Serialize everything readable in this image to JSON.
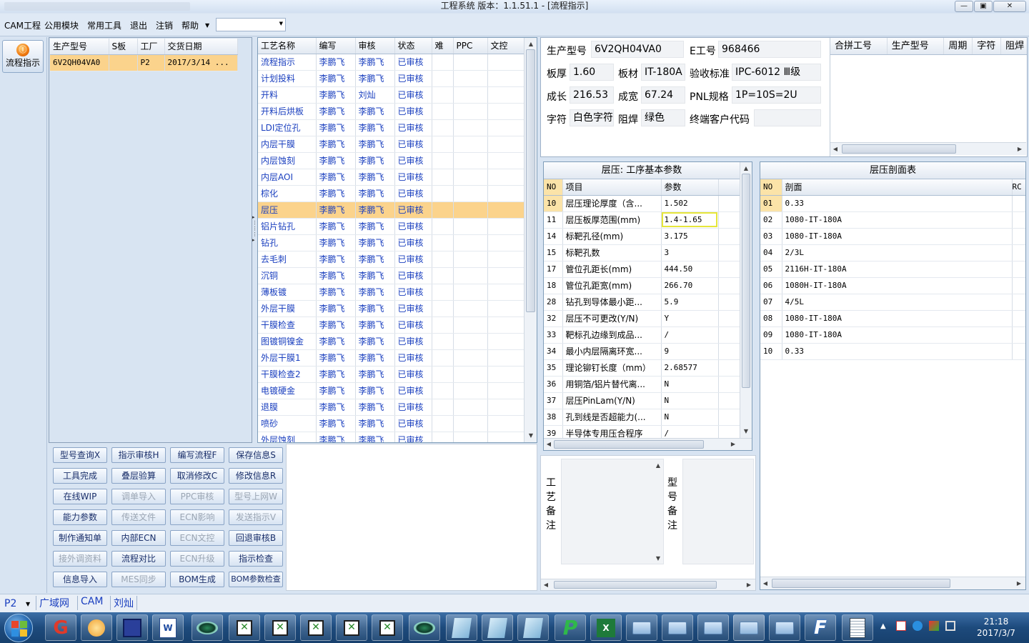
{
  "window": {
    "title": "工程系统   版本：1.1.51.1 - [流程指示]"
  },
  "menu": {
    "items": [
      "CAM工程",
      "公用模块",
      "常用工具",
      "退出",
      "注销",
      "帮助"
    ],
    "combo_value": ""
  },
  "nav": {
    "button_label": "流程指示"
  },
  "orders": {
    "columns": [
      "生产型号",
      "S板",
      "工厂",
      "交货日期"
    ],
    "rows": [
      [
        "6V2QH04VA0",
        "",
        "P2",
        "2017/3/14 ..."
      ]
    ]
  },
  "process": {
    "columns": [
      "工艺名称",
      "编写",
      "审核",
      "状态",
      "难",
      "PPC",
      "文控"
    ],
    "rows": [
      [
        "流程指示",
        "李鹏飞",
        "李鹏飞",
        "已审核"
      ],
      [
        "计划投料",
        "李鹏飞",
        "李鹏飞",
        "已审核"
      ],
      [
        "开料",
        "李鹏飞",
        "刘灿",
        "已审核"
      ],
      [
        "开料后烘板",
        "李鹏飞",
        "李鹏飞",
        "已审核"
      ],
      [
        "LDI定位孔",
        "李鹏飞",
        "李鹏飞",
        "已审核"
      ],
      [
        "内层干膜",
        "李鹏飞",
        "李鹏飞",
        "已审核"
      ],
      [
        "内层蚀刻",
        "李鹏飞",
        "李鹏飞",
        "已审核"
      ],
      [
        "内层AOI",
        "李鹏飞",
        "李鹏飞",
        "已审核"
      ],
      [
        "棕化",
        "李鹏飞",
        "李鹏飞",
        "已审核"
      ],
      [
        "层压",
        "李鹏飞",
        "李鹏飞",
        "已审核"
      ],
      [
        "铝片钻孔",
        "李鹏飞",
        "李鹏飞",
        "已审核"
      ],
      [
        "钻孔",
        "李鹏飞",
        "李鹏飞",
        "已审核"
      ],
      [
        "去毛刺",
        "李鹏飞",
        "李鹏飞",
        "已审核"
      ],
      [
        "沉铜",
        "李鹏飞",
        "李鹏飞",
        "已审核"
      ],
      [
        "薄板镀",
        "李鹏飞",
        "李鹏飞",
        "已审核"
      ],
      [
        "外层干膜",
        "李鹏飞",
        "李鹏飞",
        "已审核"
      ],
      [
        "干膜检查",
        "李鹏飞",
        "李鹏飞",
        "已审核"
      ],
      [
        "图镀铜镍金",
        "李鹏飞",
        "李鹏飞",
        "已审核"
      ],
      [
        "外层干膜1",
        "李鹏飞",
        "李鹏飞",
        "已审核"
      ],
      [
        "干膜检查2",
        "李鹏飞",
        "李鹏飞",
        "已审核"
      ],
      [
        "电镀硬金",
        "李鹏飞",
        "李鹏飞",
        "已审核"
      ],
      [
        "退膜",
        "李鹏飞",
        "李鹏飞",
        "已审核"
      ],
      [
        "喷砂",
        "李鹏飞",
        "李鹏飞",
        "已审核"
      ],
      [
        "外层蚀刻",
        "李鹏飞",
        "李鹏飞",
        "已审核"
      ]
    ]
  },
  "actions": [
    [
      "型号查询X",
      "指示审核H",
      "编写流程F",
      "保存信息S"
    ],
    [
      "工具完成",
      "叠层验算",
      "取消修改C",
      "修改信息R"
    ],
    [
      "在线WIP",
      "调单导入",
      "PPC审核",
      "型号上网W"
    ],
    [
      "能力参数",
      "传送文件",
      "ECN影响",
      "发送指示V"
    ],
    [
      "制作通知单",
      "内部ECN",
      "ECN文控",
      "回退审核B"
    ],
    [
      "接外调资料",
      "流程对比",
      "ECN升级",
      "指示检查"
    ],
    [
      "信息导入",
      "MES同步",
      "BOM生成",
      "BOM参数检查"
    ]
  ],
  "info": {
    "model_label": "生产型号",
    "model": "6V2QH04VA0",
    "eno_label": "E工号",
    "eno": "968466",
    "thickness_label": "板厚",
    "thickness": "1.60",
    "material_label": "板材",
    "material": "IT-180A",
    "standard_label": "验收标准",
    "standard": "IPC-6012 Ⅲ级",
    "length_label": "成长",
    "length": "216.53",
    "width_label": "成宽",
    "width": "67.24",
    "pnl_label": "PNL规格",
    "pnl": "1P=10S=2U",
    "char_label": "字符",
    "char": "白色字符",
    "mask_label": "阻焊",
    "mask": "绿色",
    "customer_label": "终端客户代码",
    "customer": ""
  },
  "combine": {
    "columns": [
      "合拼工号",
      "生产型号",
      "周期",
      "字符",
      "阻焊"
    ]
  },
  "params": {
    "title": "层压: 工序基本参数",
    "columns": [
      "NO",
      "项目",
      "参数"
    ],
    "rows": [
      [
        "10",
        "层压理论厚度（含...",
        "1.502"
      ],
      [
        "11",
        "层压板厚范围(mm)",
        "1.4-1.65"
      ],
      [
        "14",
        "标靶孔径(mm)",
        "3.175"
      ],
      [
        "15",
        "标靶孔数",
        "3"
      ],
      [
        "17",
        "管位孔距长(mm)",
        "444.50"
      ],
      [
        "18",
        "管位孔距宽(mm)",
        "266.70"
      ],
      [
        "28",
        "钻孔到导体最小距...",
        "5.9"
      ],
      [
        "32",
        "层压不可更改(Y/N)",
        "Y"
      ],
      [
        "33",
        "靶标孔边缘到成品...",
        "/"
      ],
      [
        "34",
        "最小内层隔离环宽...",
        "9"
      ],
      [
        "35",
        "理论铆钉长度（mm）",
        "2.68577"
      ],
      [
        "36",
        "用铜箔/铝片替代离...",
        "N"
      ],
      [
        "37",
        "层压PinLam(Y/N)",
        "N"
      ],
      [
        "38",
        "孔到线是否超能力(...",
        "N"
      ],
      [
        "39",
        "半导体专用压合程序",
        "/"
      ]
    ]
  },
  "section": {
    "title": "层压剖面表",
    "columns": [
      "NO",
      "剖面",
      "RC"
    ],
    "rows": [
      [
        "01",
        "0.33"
      ],
      [
        "02",
        "1080-IT-180A"
      ],
      [
        "03",
        "1080-IT-180A"
      ],
      [
        "04",
        "2/3L"
      ],
      [
        "05",
        "2116H-IT-180A"
      ],
      [
        "06",
        "1080H-IT-180A"
      ],
      [
        "07",
        "4/5L"
      ],
      [
        "08",
        "1080-IT-180A"
      ],
      [
        "09",
        "1080-IT-180A"
      ],
      [
        "10",
        "0.33"
      ]
    ]
  },
  "remarks": {
    "process_label": [
      "工",
      "艺",
      "备",
      "注"
    ],
    "model_label": [
      "型",
      "号",
      "备",
      "注"
    ]
  },
  "status": {
    "factory": "P2",
    "items": [
      "广域网",
      "CAM",
      "刘灿"
    ]
  },
  "taskbar": {
    "time": "21:18",
    "date": "2017/3/7"
  }
}
